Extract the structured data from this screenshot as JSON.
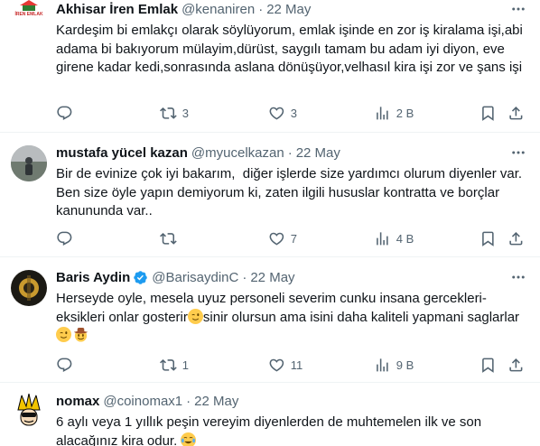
{
  "tweets": [
    {
      "name": "Akhisar İren Emlak",
      "handle": "@kenaniren",
      "time": "22 May",
      "text": "Kardeşim bi emlakçı olarak söylüyorum, emlak işinde en zor iş kiralama işi,abi adama bi bakıyorum mülayim,dürüst, saygılı tamam bu adam iyi diyon, eve girene kadar kedi,sonrasında aslana dönüşüyor,velhasıl kira işi zor ve şans işi",
      "replies": "",
      "retweets": "3",
      "likes": "3",
      "views": "2 B",
      "avatar_label": "İREN EMLAK"
    },
    {
      "name": "mustafa yücel kazan",
      "handle": "@myucelkazan",
      "time": "22 May",
      "text": "Bir de evinize çok iyi bakarım,  diğer işlerde size yardımcı olurum diyenler var. Ben size öyle yapın demiyorum ki, zaten ilgili hususlar kontratta ve borçlar kanununda var..",
      "replies": "",
      "retweets": "",
      "likes": "7",
      "views": "4 B"
    },
    {
      "name": "Baris Aydin",
      "handle": "@BarisaydinC",
      "time": "22 May",
      "text_a": "Herseyde oyle, mesela uyuz personeli severim cunku insana gercekleri-eksikleri onlar gosterir",
      "text_b": "sinir olursun ama isini daha kaliteli yapmani saglarlar",
      "replies": "",
      "retweets": "1",
      "likes": "11",
      "views": "9 B"
    },
    {
      "name": "nomax",
      "handle": "@coinomax1",
      "time": "22 May",
      "text": "6 aylı veya 1 yıllık peşin vereyim diyenlerden de muhtemelen ilk ve son alacağınız kira odur."
    }
  ],
  "colors": {
    "text_primary": "#0f1419",
    "text_secondary": "#536471",
    "verified_blue": "#1d9bf0",
    "divider": "#eff3f4"
  },
  "icons": [
    "more-icon",
    "reply-icon",
    "retweet-icon",
    "like-icon",
    "views-icon",
    "bookmark-icon",
    "share-icon",
    "verified-icon"
  ]
}
